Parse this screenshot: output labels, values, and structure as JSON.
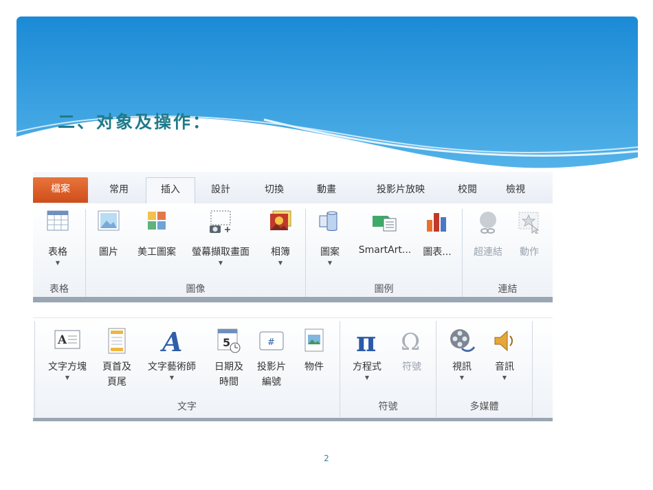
{
  "slide": {
    "title": "二、对象及操作：",
    "page_number": "2"
  },
  "ribbon1": {
    "tabs": [
      "檔案",
      "常用",
      "插入",
      "設計",
      "切換",
      "動畫",
      "投影片放映",
      "校閱",
      "檢視"
    ],
    "active_tab": "插入",
    "buttons": {
      "table": "表格",
      "picture": "圖片",
      "clipart": "美工圖案",
      "screenshot": "螢幕擷取畫面",
      "album": "相簿",
      "shapes": "圖案",
      "smartart": "SmartArt...",
      "chart": "圖表...",
      "hyperlink": "超連結",
      "action": "動作"
    },
    "groups": {
      "tables": "表格",
      "images": "圖像",
      "illustrations": "圖例",
      "links": "連結"
    }
  },
  "ribbon2": {
    "buttons": {
      "textbox": "文字方塊",
      "header_footer_1": "頁首及",
      "header_footer_2": "頁尾",
      "wordart": "文字藝術師",
      "datetime_1": "日期及",
      "datetime_2": "時間",
      "slide_number_1": "投影片",
      "slide_number_2": "編號",
      "object": "物件",
      "equation": "方程式",
      "symbol": "符號",
      "video": "視訊",
      "audio": "音訊"
    },
    "groups": {
      "text": "文字",
      "symbols": "符號",
      "media": "多媒體"
    }
  },
  "colors": {
    "header_blue": "#1f8fd8",
    "title_teal": "#1e7a8a",
    "file_tab": "#d9552a"
  }
}
